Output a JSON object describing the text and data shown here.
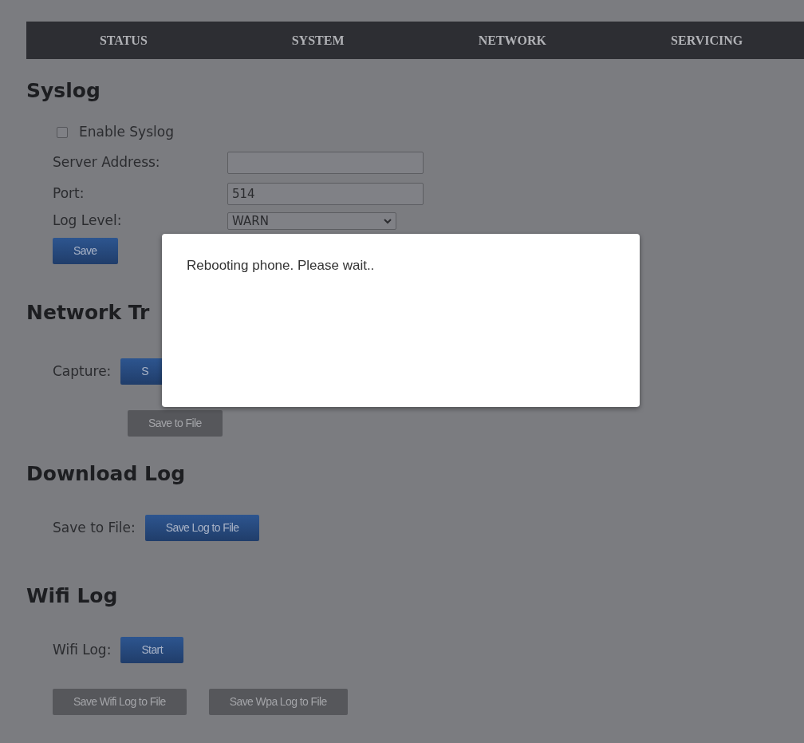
{
  "nav": {
    "tabs": [
      {
        "label": "STATUS"
      },
      {
        "label": "SYSTEM"
      },
      {
        "label": "NETWORK"
      },
      {
        "label": "SERVICING"
      }
    ]
  },
  "sections": [
    {
      "heading": "Syslog",
      "items": [
        {
          "kind": "checkbox",
          "label": "Enable Syslog",
          "checked": false
        },
        {
          "kind": "field",
          "label": "Server Address:",
          "value": ""
        },
        {
          "kind": "field",
          "label": "Port:",
          "value": "514"
        },
        {
          "kind": "select",
          "label": "Log Level:",
          "value": "WARN"
        },
        {
          "kind": "buttons",
          "buttons": [
            {
              "label": "Save",
              "disabled": false
            }
          ]
        }
      ]
    },
    {
      "heading": "Network Tr",
      "items": [
        {
          "kind": "labeled",
          "label": "Capture:",
          "buttons": [
            {
              "label": "S",
              "disabled": false
            }
          ]
        },
        {
          "kind": "buttons",
          "indent": true,
          "buttons": [
            {
              "label": "Save to File",
              "disabled": true
            }
          ]
        }
      ]
    },
    {
      "heading": "Download Log",
      "items": [
        {
          "kind": "labeled",
          "label": "Save to File:",
          "buttons": [
            {
              "label": "Save Log to File",
              "disabled": false
            }
          ]
        }
      ]
    },
    {
      "heading": "Wifi Log",
      "items": [
        {
          "kind": "labeled",
          "label": "Wifi Log:",
          "buttons": [
            {
              "label": "Start",
              "disabled": false
            }
          ]
        },
        {
          "kind": "buttons",
          "buttons": [
            {
              "label": "Save Wifi Log to File",
              "disabled": true
            },
            {
              "label": "Save Wpa Log to File",
              "disabled": true
            }
          ]
        }
      ]
    }
  ],
  "dialog": {
    "message": "Rebooting phone. Please wait.."
  }
}
